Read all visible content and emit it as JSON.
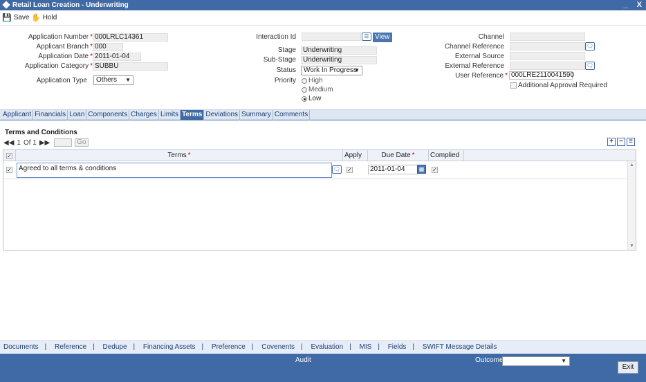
{
  "window": {
    "title": "Retail Loan Creation - Underwriting",
    "min": "_",
    "close": "X"
  },
  "toolbar": {
    "save": "Save",
    "hold": "Hold"
  },
  "form": {
    "app_number_label": "Application Number",
    "app_number": "000LRLC14361",
    "branch_label": "Applicant Branch",
    "branch": "000",
    "app_date_label": "Application Date",
    "app_date": "2011-01-04",
    "category_label": "Application Category",
    "category": "SUBBU",
    "type_label": "Application Type",
    "type": "Others",
    "interaction_label": "Interaction Id",
    "interaction": "",
    "view": "View",
    "stage_label": "Stage",
    "stage": "Underwriting",
    "substage_label": "Sub-Stage",
    "substage": "Underwriting",
    "status_label": "Status",
    "status": "Work In Progress",
    "priority_label": "Priority",
    "priority_high": "High",
    "priority_medium": "Medium",
    "priority_low": "Low",
    "channel_label": "Channel",
    "channel": "",
    "channel_ref_label": "Channel Reference",
    "channel_ref": "",
    "ext_source_label": "External Source",
    "ext_source": "",
    "ext_ref_label": "External Reference",
    "ext_ref": "",
    "user_ref_label": "User Reference",
    "user_ref": "000LRE2110041590",
    "additional_approval": "Additional Approval Required"
  },
  "tabs": [
    "Applicant",
    "Financials",
    "Loan",
    "Components",
    "Charges",
    "Limits",
    "Terms",
    "Deviations",
    "Summary",
    "Comments"
  ],
  "terms": {
    "title": "Terms and Conditions",
    "pager": {
      "page": "1",
      "of": "Of 1",
      "go": "Go"
    },
    "headers": {
      "terms": "Terms",
      "apply": "Apply",
      "due_date": "Due Date",
      "complied": "Complied"
    },
    "row": {
      "terms": "Agreed to all terms & conditions",
      "due_date": "2011-01-04"
    }
  },
  "footer_links": [
    "Documents",
    "Reference",
    "Dedupe",
    "Financing Assets",
    "Preference",
    "Covenents",
    "Evaluation",
    "MIS",
    "Fields",
    "SWIFT Message Details"
  ],
  "bottom": {
    "audit": "Audit",
    "outcome": "Outcome",
    "exit": "Exit"
  }
}
